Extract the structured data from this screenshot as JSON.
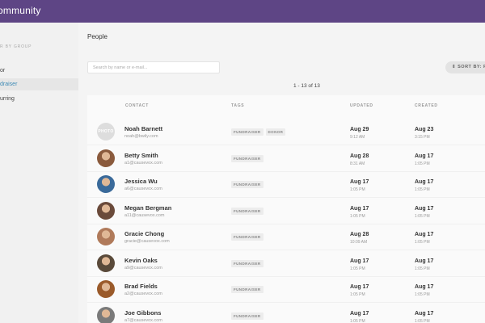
{
  "app": {
    "title": "ommunity"
  },
  "sidebar": {
    "filter_label": "R BY GROUP",
    "items": [
      {
        "label": "or",
        "active": false
      },
      {
        "label": "draiser",
        "active": true
      },
      {
        "label": "urring",
        "active": false
      }
    ]
  },
  "main": {
    "title": "People",
    "search_placeholder": "Search by name or e-mail...",
    "sort_label": "⇕ SORT BY: REC",
    "count": "1 - 13 of 13"
  },
  "table": {
    "columns": [
      "CONTACT",
      "TAGS",
      "UPDATED",
      "CREATED"
    ],
    "rows": [
      {
        "name": "Noah Barnett",
        "email": "noah@bwily.com",
        "avatar": "PHOTO",
        "tags": [
          "FUNDRAISER",
          "DONOR"
        ],
        "updated_date": "Aug 29",
        "updated_time": "9:12 AM",
        "created_date": "Aug 23",
        "created_time": "3:15 PM"
      },
      {
        "name": "Betty Smith",
        "email": "a1@causevox.com",
        "avatar": "",
        "tags": [
          "FUNDRAISER"
        ],
        "updated_date": "Aug 28",
        "updated_time": "8:31 AM",
        "created_date": "Aug 17",
        "created_time": "1:05 PM"
      },
      {
        "name": "Jessica Wu",
        "email": "a6@causevox.com",
        "avatar": "",
        "tags": [
          "FUNDRAISER"
        ],
        "updated_date": "Aug 17",
        "updated_time": "1:05 PM",
        "created_date": "Aug 17",
        "created_time": "1:05 PM"
      },
      {
        "name": "Megan Bergman",
        "email": "a11@causevox.com",
        "avatar": "",
        "tags": [
          "FUNDRAISER"
        ],
        "updated_date": "Aug 17",
        "updated_time": "1:05 PM",
        "created_date": "Aug 17",
        "created_time": "1:05 PM"
      },
      {
        "name": "Gracie Chong",
        "email": "gracie@causevox.com",
        "avatar": "",
        "tags": [
          "FUNDRAISER"
        ],
        "updated_date": "Aug 28",
        "updated_time": "10:09 AM",
        "created_date": "Aug 17",
        "created_time": "1:05 PM"
      },
      {
        "name": "Kevin Oaks",
        "email": "a9@causevox.com",
        "avatar": "",
        "tags": [
          "FUNDRAISER"
        ],
        "updated_date": "Aug 17",
        "updated_time": "1:05 PM",
        "created_date": "Aug 17",
        "created_time": "1:05 PM"
      },
      {
        "name": "Brad Fields",
        "email": "a2@causevox.com",
        "avatar": "",
        "tags": [
          "FUNDRAISER"
        ],
        "updated_date": "Aug 17",
        "updated_time": "1:05 PM",
        "created_date": "Aug 17",
        "created_time": "1:05 PM"
      },
      {
        "name": "Joe Gibbons",
        "email": "a7@causevox.com",
        "avatar": "",
        "tags": [
          "FUNDRAISER"
        ],
        "updated_date": "Aug 17",
        "updated_time": "1:05 PM",
        "created_date": "Aug 17",
        "created_time": "1:05 PM"
      }
    ]
  },
  "colors": {
    "header": "#5e4585",
    "active_link": "#3d8ab5"
  }
}
